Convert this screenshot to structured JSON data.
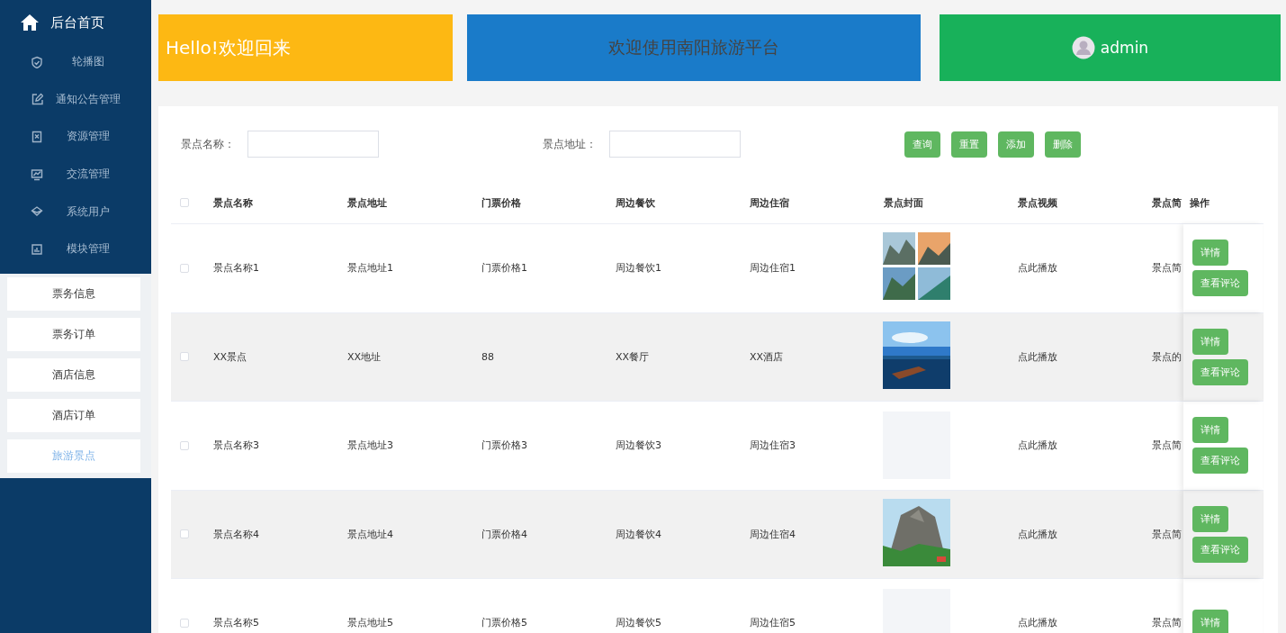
{
  "sidebar": {
    "home": "后台首页",
    "items": [
      {
        "label": "轮播图"
      },
      {
        "label": "通知公告管理"
      },
      {
        "label": "资源管理"
      },
      {
        "label": "交流管理"
      },
      {
        "label": "系统用户"
      },
      {
        "label": "模块管理"
      }
    ],
    "submenu": [
      {
        "label": "票务信息",
        "selected": false
      },
      {
        "label": "票务订单",
        "selected": false
      },
      {
        "label": "酒店信息",
        "selected": false
      },
      {
        "label": "酒店订单",
        "selected": false
      },
      {
        "label": "旅游景点",
        "selected": true
      }
    ]
  },
  "banners": [
    {
      "kind": "greeting",
      "text": "Hello!欢迎回来",
      "color": "#fdb813"
    },
    {
      "kind": "title",
      "text": "欢迎使用南阳旅游平台",
      "color": "#1a7bc9"
    },
    {
      "kind": "user",
      "text": "admin",
      "color": "#18b15a"
    }
  ],
  "search": {
    "fields": [
      {
        "label": "景点名称："
      },
      {
        "label": "景点地址："
      }
    ],
    "buttons": [
      "查询",
      "重置",
      "添加",
      "删除"
    ]
  },
  "table": {
    "all_checked": false,
    "columns": [
      "景点名称",
      "景点地址",
      "门票价格",
      "周边餐饮",
      "周边住宿",
      "景点封面",
      "景点视频",
      "景点简",
      "操作"
    ],
    "rows": [
      {
        "checked": false,
        "cells": [
          "景点名称1",
          "景点地址1",
          "门票价格1",
          "周边餐饮1",
          "周边住宿1"
        ],
        "cover": {
          "kind": "picture"
        },
        "video": "点此播放",
        "intro": "景点简",
        "actions": [
          "详情",
          "查看评论"
        ]
      },
      {
        "checked": false,
        "cells": [
          "XX景点",
          "XX地址",
          "88",
          "XX餐厅",
          "XX酒店"
        ],
        "cover": {
          "kind": "picture"
        },
        "video": "点此播放",
        "intro": "景点的",
        "actions": [
          "详情",
          "查看评论"
        ]
      },
      {
        "checked": false,
        "cells": [
          "景点名称3",
          "景点地址3",
          "门票价格3",
          "周边餐饮3",
          "周边住宿3"
        ],
        "cover": {
          "kind": "empty"
        },
        "video": "点此播放",
        "intro": "景点简",
        "actions": [
          "详情",
          "查看评论"
        ]
      },
      {
        "checked": false,
        "cells": [
          "景点名称4",
          "景点地址4",
          "门票价格4",
          "周边餐饮4",
          "周边住宿4"
        ],
        "cover": {
          "kind": "picture"
        },
        "video": "点此播放",
        "intro": "景点简",
        "actions": [
          "详情",
          "查看评论"
        ]
      },
      {
        "checked": false,
        "cells": [
          "景点名称5",
          "景点地址5",
          "门票价格5",
          "周边餐饮5",
          "周边住宿5"
        ],
        "cover": {
          "kind": "empty"
        },
        "video": "点此播放",
        "intro": "景点简",
        "actions": [
          "详情"
        ]
      }
    ]
  }
}
